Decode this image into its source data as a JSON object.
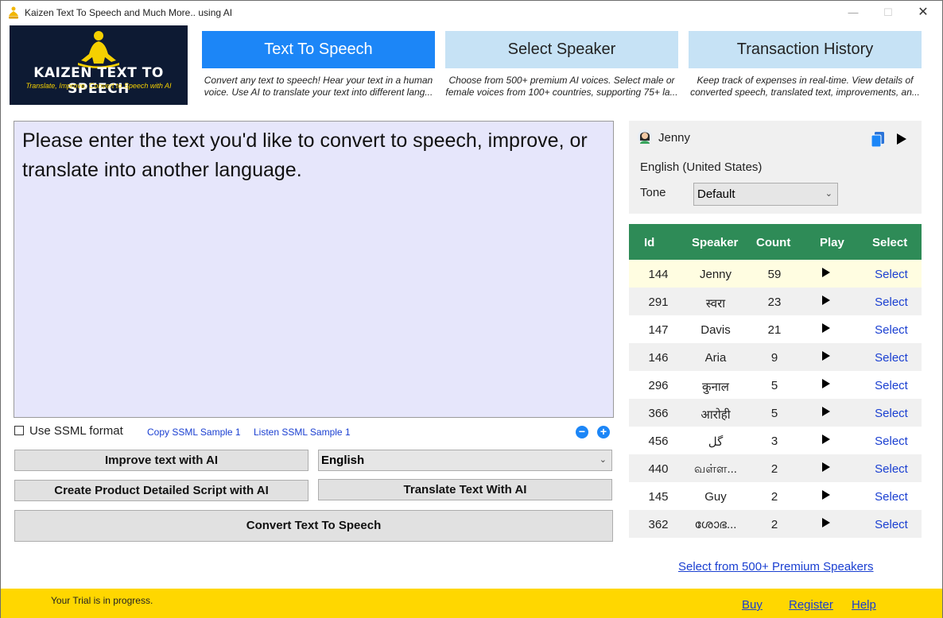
{
  "window": {
    "title": "Kaizen Text To Speech and Much More.. using AI",
    "minimize": "—",
    "maximize": "☐",
    "close": "✕"
  },
  "logo": {
    "title": "KAIZEN TEXT TO SPEECH",
    "subtitle": "Translate, Improve, Convert to Speech with AI"
  },
  "tabs": [
    {
      "label": "Text To Speech",
      "active": true,
      "desc1": "Convert any text to speech! Hear your text in a human",
      "desc2": "voice. Use AI to translate your text into different lang..."
    },
    {
      "label": "Select Speaker",
      "active": false,
      "desc1": "Choose from 500+ premium AI voices. Select male or",
      "desc2": "female voices from 100+ countries, supporting 75+ la..."
    },
    {
      "label": "Transaction History",
      "active": false,
      "desc1": "Keep track of expenses in real-time. View details of",
      "desc2": "converted speech, translated text, improvements, an..."
    }
  ],
  "editor": {
    "placeholder": "Please enter the text you'd like to convert to speech, improve, or translate into another language."
  },
  "ssml": {
    "label": "Use SSML format",
    "copy_link": "Copy SSML Sample 1",
    "listen_link": "Listen SSML Sample 1",
    "zoom_out": "−",
    "zoom_in": "+"
  },
  "actions": {
    "improve": "Improve text with AI",
    "language": "English",
    "script": "Create Product Detailed Script with AI",
    "translate": "Translate Text With AI",
    "convert": "Convert Text To Speech"
  },
  "speaker": {
    "name": "Jenny",
    "language": "English (United States)",
    "tone_label": "Tone",
    "tone_value": "Default"
  },
  "table": {
    "headers": [
      "Id",
      "Speaker",
      "Count",
      "Play",
      "Select"
    ],
    "rows": [
      {
        "id": "144",
        "speaker": "Jenny",
        "count": "59",
        "select": "Select"
      },
      {
        "id": "291",
        "speaker": "स्वरा",
        "count": "23",
        "select": "Select"
      },
      {
        "id": "147",
        "speaker": "Davis",
        "count": "21",
        "select": "Select"
      },
      {
        "id": "146",
        "speaker": "Aria",
        "count": "9",
        "select": "Select"
      },
      {
        "id": "296",
        "speaker": "कुनाल",
        "count": "5",
        "select": "Select"
      },
      {
        "id": "366",
        "speaker": "आरोही",
        "count": "5",
        "select": "Select"
      },
      {
        "id": "456",
        "speaker": "گل",
        "count": "3",
        "select": "Select"
      },
      {
        "id": "440",
        "speaker": "வள்ள...",
        "count": "2",
        "select": "Select"
      },
      {
        "id": "145",
        "speaker": "Guy",
        "count": "2",
        "select": "Select"
      },
      {
        "id": "362",
        "speaker": "ശോഭ...",
        "count": "2",
        "select": "Select"
      }
    ]
  },
  "premium_link": "Select from 500+ Premium Speakers",
  "status": {
    "text": "Your Trial is in progress.",
    "buy": "Buy",
    "register": "Register",
    "help": "Help"
  },
  "colors": {
    "accent_blue": "#1c86f7",
    "tab_inactive": "#c6e2f5",
    "table_header": "#2e8b57",
    "status_bar": "#ffd700",
    "editor_bg": "#e6e6fb"
  }
}
